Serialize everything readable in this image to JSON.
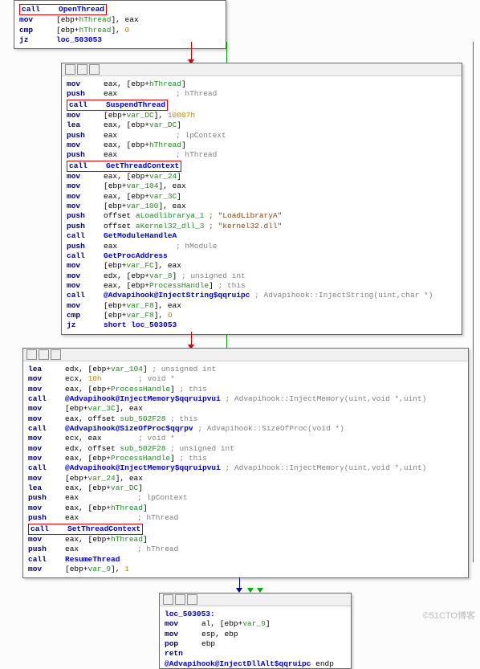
{
  "b1": {
    "l1": {
      "m": "call",
      "o": "OpenThread"
    },
    "l2": {
      "m": "mov",
      "r": "[ebp+",
      "v": "hThread",
      "r2": "], eax"
    },
    "l3": {
      "m": "cmp",
      "r": "[ebp+",
      "v": "hThread",
      "r2": "], ",
      "n": "0"
    },
    "l4": {
      "m": "jz",
      "o": "loc_503053"
    }
  },
  "b2": {
    "l1": {
      "m": "mov",
      "t": "eax, [ebp+",
      "v": "hThread",
      "t2": "]"
    },
    "l2": {
      "m": "push",
      "t": "eax",
      "c": "; hThread"
    },
    "l3": {
      "m": "call",
      "o": "SuspendThread"
    },
    "l4": {
      "m": "mov",
      "t": "[ebp+",
      "v": "var_DC",
      "t2": "], ",
      "n": "10007h"
    },
    "l5": {
      "m": "lea",
      "t": "eax, [ebp+",
      "v": "var_DC",
      "t2": "]"
    },
    "l6": {
      "m": "push",
      "t": "eax",
      "c": "; lpContext"
    },
    "l7": {
      "m": "mov",
      "t": "eax, [ebp+",
      "v": "hThread",
      "t2": "]"
    },
    "l8": {
      "m": "push",
      "t": "eax",
      "c": "; hThread"
    },
    "l9": {
      "m": "call",
      "o": "GetThreadContext"
    },
    "l10": {
      "m": "mov",
      "t": "eax, [ebp+",
      "v": "var_24",
      "t2": "]"
    },
    "l11": {
      "m": "mov",
      "t": "[ebp+",
      "v": "var_104",
      "t2": "], eax"
    },
    "l12": {
      "m": "mov",
      "t": "eax, [ebp+",
      "v": "var_3C",
      "t2": "]"
    },
    "l13": {
      "m": "mov",
      "t": "[ebp+",
      "v": "var_100",
      "t2": "], eax"
    },
    "l14": {
      "m": "push",
      "t": "offset ",
      "v": "aLoadlibrarya_1",
      "c": " ; \"LoadLibraryA\""
    },
    "l15": {
      "m": "push",
      "t": "offset ",
      "v": "aKernel32_dll_3",
      "c": " ; \"kernel32.dll\""
    },
    "l16": {
      "m": "call",
      "o": "GetModuleHandleA"
    },
    "l17": {
      "m": "push",
      "t": "eax",
      "c": "; hModule"
    },
    "l18": {
      "m": "call",
      "o": "GetProcAddress"
    },
    "l19": {
      "m": "mov",
      "t": "[ebp+",
      "v": "var_FC",
      "t2": "], eax"
    },
    "l20": {
      "m": "mov",
      "t": "edx, [ebp+",
      "v": "var_8",
      "t2": "] ",
      "c": "; unsigned int"
    },
    "l21": {
      "m": "mov",
      "t": "eax, [ebp+",
      "v": "ProcessHandle",
      "t2": "] ",
      "c": "; this"
    },
    "l22": {
      "m": "call",
      "o": "@Advapihook@InjectString$qqruipc",
      "c": " ; Advapihook::InjectString(uint,char *)"
    },
    "l23": {
      "m": "mov",
      "t": "[ebp+",
      "v": "var_F8",
      "t2": "], eax"
    },
    "l24": {
      "m": "cmp",
      "t": "[ebp+",
      "v": "var_F8",
      "t2": "], ",
      "n": "0"
    },
    "l25": {
      "m": "jz",
      "o": "short loc_503053"
    }
  },
  "b3": {
    "l1": {
      "m": "lea",
      "t": "edx, [ebp+",
      "v": "var_104",
      "t2": "] ",
      "c": "; unsigned int"
    },
    "l2": {
      "m": "mov",
      "t": "ecx, ",
      "n": "10h",
      "c": "        ; void *"
    },
    "l3": {
      "m": "mov",
      "t": "eax, [ebp+",
      "v": "ProcessHandle",
      "t2": "] ",
      "c": "; this"
    },
    "l4": {
      "m": "call",
      "o": "@Advapihook@InjectMemory$qqruipvui",
      "c": " ; Advapihook::InjectMemory(uint,void *,uint)"
    },
    "l5": {
      "m": "mov",
      "t": "[ebp+",
      "v": "var_3C",
      "t2": "], eax"
    },
    "l6": {
      "m": "mov",
      "t": "eax, offset ",
      "v": "sub_502F28",
      "c": " ; this"
    },
    "l7": {
      "m": "call",
      "o": "@Advapihook@SizeOfProc$qqrpv",
      "c": " ; Advapihook::SizeOfProc(void *)"
    },
    "l8": {
      "m": "mov",
      "t": "ecx, eax",
      "c": "        ; void *"
    },
    "l9": {
      "m": "mov",
      "t": "edx, offset ",
      "v": "sub_502F28",
      "c": " ; unsigned int"
    },
    "l10": {
      "m": "mov",
      "t": "eax, [ebp+",
      "v": "ProcessHandle",
      "t2": "] ",
      "c": "; this"
    },
    "l11": {
      "m": "call",
      "o": "@Advapihook@InjectMemory$qqruipvui",
      "c": " ; Advapihook::InjectMemory(uint,void *,uint)"
    },
    "l12": {
      "m": "mov",
      "t": "[ebp+",
      "v": "var_24",
      "t2": "], eax"
    },
    "l13": {
      "m": "lea",
      "t": "eax, [ebp+",
      "v": "var_DC",
      "t2": "]"
    },
    "l14": {
      "m": "push",
      "t": "eax",
      "c": "; lpContext"
    },
    "l15": {
      "m": "mov",
      "t": "eax, [ebp+",
      "v": "hThread",
      "t2": "]"
    },
    "l16": {
      "m": "push",
      "t": "eax",
      "c": "; hThread"
    },
    "l17": {
      "m": "call",
      "o": "SetThreadContext"
    },
    "l18": {
      "m": "mov",
      "t": "eax, [ebp+",
      "v": "hThread",
      "t2": "]"
    },
    "l19": {
      "m": "push",
      "t": "eax",
      "c": "; hThread"
    },
    "l20": {
      "m": "call",
      "o": "ResumeThread"
    },
    "l21": {
      "m": "mov",
      "t": "[ebp+",
      "v": "var_9",
      "t2": "], ",
      "n": "1"
    }
  },
  "b4": {
    "l1": {
      "t": "loc_503053:"
    },
    "l2": {
      "m": "mov",
      "t": "al, [ebp+",
      "v": "var_9",
      "t2": "]"
    },
    "l3": {
      "m": "mov",
      "t": "esp, ebp"
    },
    "l4": {
      "m": "pop",
      "t": "ebp"
    },
    "l5": {
      "m": "retn"
    },
    "l6": {
      "o": "@Advapihook@InjectDllAlt$qqruipc",
      "t": " endp"
    }
  },
  "wm": "©51CTO博客"
}
